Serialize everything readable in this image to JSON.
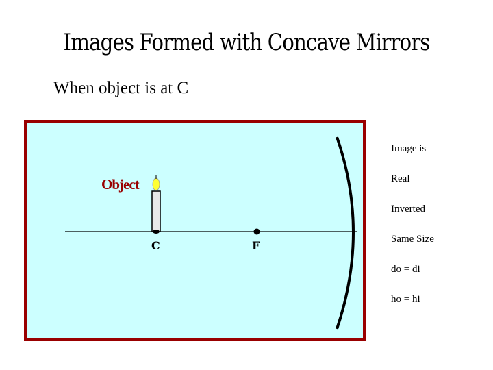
{
  "slide": {
    "title": "Images Formed with Concave Mirrors",
    "subtitle": "When object is at C"
  },
  "diagram": {
    "object_label": "Object",
    "point_c_label": "C",
    "point_f_label": "F",
    "colors": {
      "border": "#990000",
      "background": "#ccffff",
      "object_label": "#990000",
      "flame": "#ffff33",
      "candle": "#e8e8e8"
    }
  },
  "properties": {
    "items": [
      "Image is",
      "Real",
      "Inverted",
      "Same Size",
      "do = di",
      "ho = hi"
    ]
  }
}
